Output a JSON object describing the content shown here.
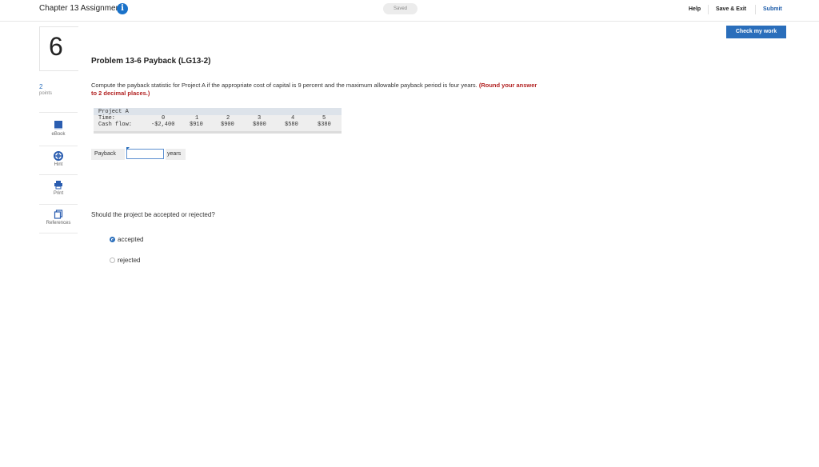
{
  "header": {
    "title": "Chapter 13 Assignment",
    "info_icon": "i",
    "status": "Saved",
    "help": "Help",
    "save_exit": "Save & Exit",
    "submit": "Submit"
  },
  "check_my_work": "Check my work",
  "question_number": "6",
  "points": {
    "value": "2",
    "label": "points"
  },
  "tools": [
    {
      "label": "eBook",
      "icon": "book-icon"
    },
    {
      "label": "Hint",
      "icon": "lifebuoy-icon"
    },
    {
      "label": "Print",
      "icon": "printer-icon"
    },
    {
      "label": "References",
      "icon": "references-icon"
    }
  ],
  "problem": {
    "title": "Problem 13-6 Payback (LG13-2)",
    "prompt": "Compute the payback statistic for Project A if the appropriate cost of capital is 9 percent and the maximum allowable payback period is four years.",
    "instruction": "(Round your answer to 2 decimal places.)"
  },
  "cash_flow_table": {
    "project": "Project A",
    "time_label": "Time:",
    "cash_flow_label": "Cash flow:",
    "times": [
      "0",
      "1",
      "2",
      "3",
      "4",
      "5"
    ],
    "cash_flows": [
      "-$2,400",
      "$910",
      "$900",
      "$800",
      "$580",
      "$380"
    ]
  },
  "payback": {
    "label": "Payback",
    "value": "",
    "unit": "years"
  },
  "decision": {
    "question": "Should the project be accepted or rejected?",
    "options": [
      {
        "label": "accepted",
        "selected": true
      },
      {
        "label": "rejected",
        "selected": false
      }
    ]
  }
}
